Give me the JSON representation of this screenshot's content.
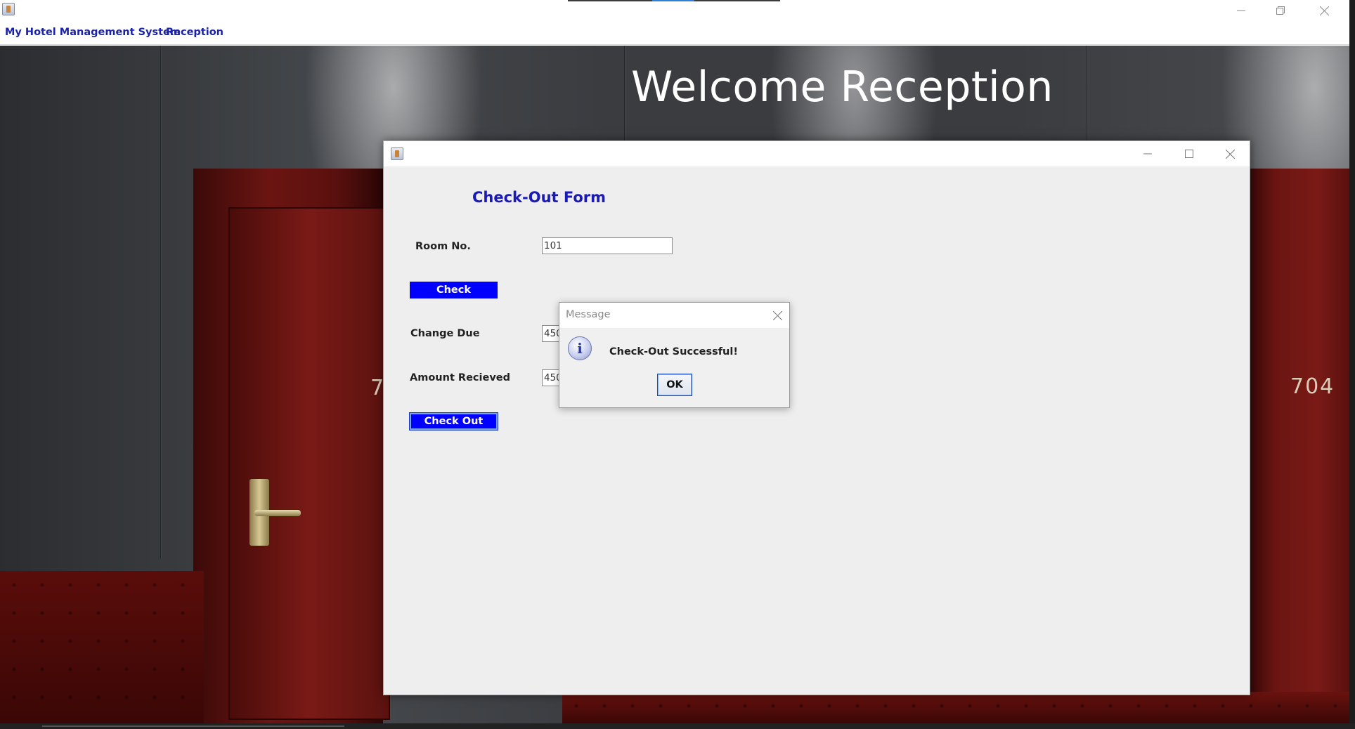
{
  "window": {
    "icon": "java-cup-icon",
    "controls": [
      "minimize-icon",
      "restore-icon",
      "close-icon"
    ]
  },
  "menu": {
    "items": [
      "My Hotel Management System",
      "Reception"
    ]
  },
  "background": {
    "heading": "Welcome Reception",
    "door_numbers": [
      "7",
      "704"
    ]
  },
  "checkout_form": {
    "icon": "java-cup-icon",
    "controls": [
      "minimize-icon",
      "maximize-icon",
      "close-icon"
    ],
    "heading": "Check-Out Form",
    "room_no_label": "Room No.",
    "room_no_value": "101",
    "check_button": "Check",
    "change_due_label": "Change Due",
    "change_due_value": "450",
    "amount_received_label": "Amount Recieved",
    "amount_received_value": "450",
    "checkout_button": "Check Out",
    "accent_color": "#0000ff",
    "heading_color": "#1a1ab8"
  },
  "message_dialog": {
    "title": "Message",
    "icon": "info-icon",
    "info_glyph": "i",
    "text": "Check-Out Successful!",
    "ok_button": "OK"
  }
}
